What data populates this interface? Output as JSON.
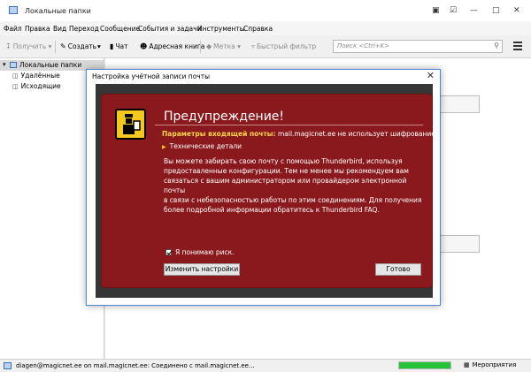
{
  "window": {
    "title": "Локальные папки",
    "controls": [
      "▣",
      "☑",
      "—",
      "□",
      "✕"
    ]
  },
  "menu": [
    "Файл",
    "Правка",
    "Вид",
    "Переход",
    "Сообщение",
    "События и задачи",
    "Инструменты",
    "Справка"
  ],
  "toolbar": {
    "get": "Получить",
    "create": "Создать",
    "chat": "Чат",
    "addressbook": "Адресная книга",
    "tag": "Метка",
    "quickfilter": "Быстрый фильтр",
    "search_placeholder": "Поиск <Ctrl+K>"
  },
  "folders": {
    "root": "Локальные папки",
    "items": [
      "Удалённые",
      "Исходящие"
    ]
  },
  "dialog": {
    "title": "Настройка учётной записи почты",
    "heading": "Предупреждение!",
    "param_label": "Параметры входящей почты:",
    "param_value": "mail.magicnet.ee не использует шифрование.",
    "tech_details": "Технические детали",
    "body_lines": [
      "Вы можете забирать свою почту с помощью Thunderbird, используя",
      "предоставленные конфигурации. Тем не менее мы рекомендуем вам",
      "связаться с вашим администратором или провайдером электронной почты",
      "в связи с небезопасностью работы по этим соединениям. Для получения",
      "более подробной информации обратитесь к Thunderbird FAQ."
    ],
    "understand": "Я понимаю риск.",
    "change_button": "Изменить настройки",
    "done_button": "Готово"
  },
  "status": {
    "text": "diagen@magicnet.ee on mail.magicnet.ee: Соединено с mail.magicnet.ee...",
    "events": "Мероприятия",
    "progress_percent": 100
  },
  "colors": {
    "warning_bg": "#8a191d",
    "warning_label": "#ffd54a",
    "icon_yellow": "#f4c81f",
    "progress": "#25c33a",
    "dialog_border": "#4a87d6"
  }
}
